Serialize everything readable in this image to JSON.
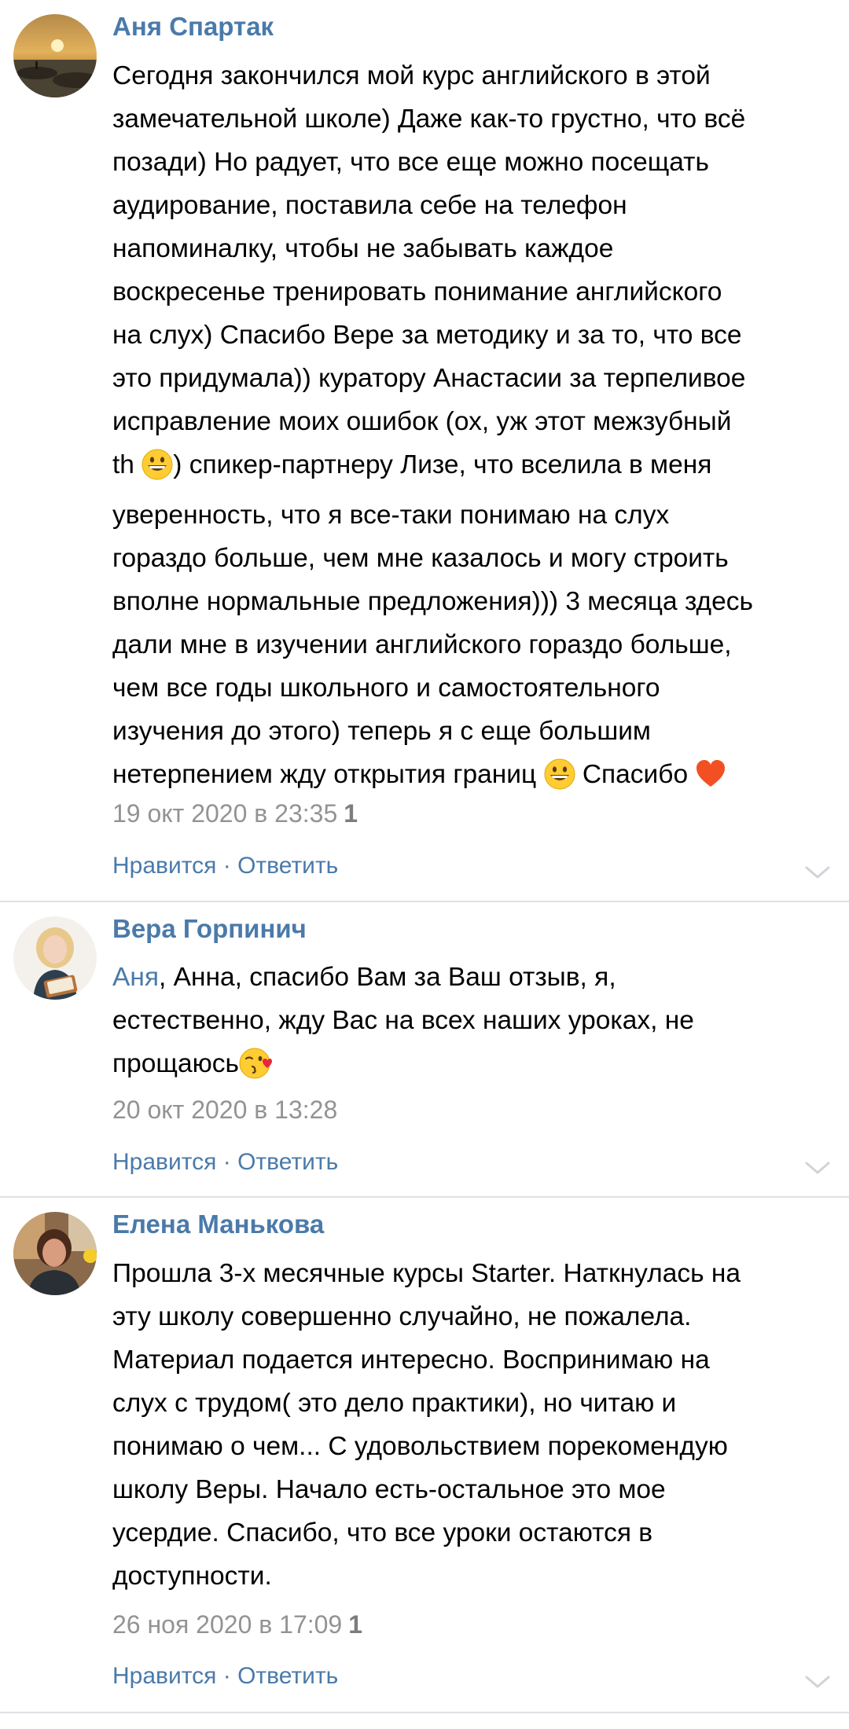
{
  "comments": [
    {
      "author": "Аня Спартак",
      "lines": [
        "Сегодня закончился мой курс английского в этой",
        "замечательной школе) Даже как-то грустно, что всё",
        "позади) Но радует, что все еще можно посещать",
        "аудирование, поставила себе на телефон",
        "напоминалку, чтобы не забывать каждое",
        "воскресенье тренировать понимание английского",
        "на слух) Спасибо Вере за методику и за то, что все",
        "это придумала)) куратору Анастасии за терпеливое",
        "исправление моих ошибок (ох, уж этот межзубный",
        ") спикер-партнеру Лизе, что вселила в меня",
        "уверенность, что я все-таки понимаю на слух",
        "гораздо больше, чем мне казалось и могу строить",
        "вполне нормальные предложения))) 3 месяца здесь",
        "дали мне в изучении английского гораздо больше,",
        "чем все годы школьного и самостоятельного",
        "изучения до этого) теперь я с еще большим",
        "нетерпением жду открытия границ",
        "Спасибо"
      ],
      "line10_prefix": "th",
      "date": "19 окт 2020 в 23:35",
      "likes": "1",
      "like_label": "Нравится",
      "separator": "·",
      "reply_label": "Ответить"
    },
    {
      "author": "Вера Горпинич",
      "mention": "Аня",
      "lines": [
        ", Анна, спасибо Вам за Ваш отзыв, я,",
        "естественно, жду Вас на всех наших уроках, не",
        "прощаюсь"
      ],
      "date": "20 окт 2020 в 13:28",
      "like_label": "Нравится",
      "separator": "·",
      "reply_label": "Ответить"
    },
    {
      "author": "Елена Манькова",
      "lines": [
        "Прошла 3-х месячные курсы Starter. Наткнулась на",
        "эту школу совершенно случайно, не пожалела.",
        "Материал подается интересно. Воспринимаю на",
        "слух с трудом( это дело практики), но читаю и",
        "понимаю о чем... С удовольствием порекомендую",
        "школу Веры. Начало есть-остальное это мое",
        "усердие. Спасибо, что все уроки остаются в",
        "доступности."
      ],
      "date": "26 ноя 2020 в 17:09",
      "likes": "1",
      "like_label": "Нравится",
      "separator": "·",
      "reply_label": "Ответить"
    }
  ],
  "icons": {
    "grin": "grinning-face-emoji",
    "heart": "orange-heart-emoji",
    "kiss": "face-blowing-kiss-emoji",
    "chevron": "chevron-down-icon"
  },
  "colors": {
    "link": "#4a7aaa",
    "meta": "#939393",
    "divider": "#dfe2e6"
  }
}
